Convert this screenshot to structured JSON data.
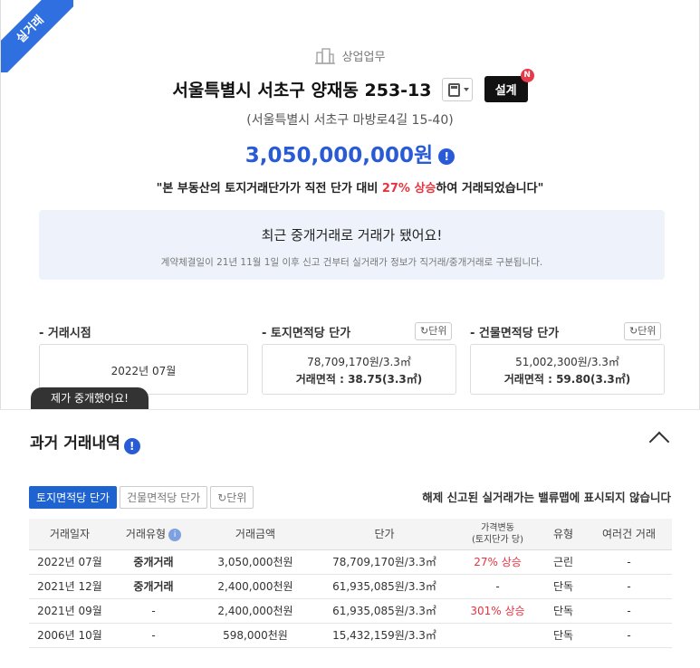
{
  "ribbon": "실거래",
  "property": {
    "category": "상업업무",
    "address": "서울특별시 서초구 양재동 253-13",
    "road_address": "(서울특별시 서초구 마방로4길 15-40)",
    "price": "3,050,000,000원",
    "design_button": "설계",
    "new_badge": "N",
    "quote_prefix": "\"본 부동산의 토지거래단가가 직전 단가 대비 ",
    "quote_highlight": "27% 상승",
    "quote_suffix": "하여 거래되었습니다\""
  },
  "notice": {
    "title": "최근 중개거래로 거래가 됐어요!",
    "subtitle": "계약체결일이 21년 11월 1일 이후 신고 건부터 실거래가 정보가 직거래/중개거래로 구분됩니다."
  },
  "summary": {
    "unit_label": "단위",
    "trade_date": {
      "label": "- 거래시점",
      "value": "2022년 07월"
    },
    "land": {
      "label": "- 토지면적당 단가",
      "unit_price": "78,709,170원/3.3㎡",
      "area": "거래면적 : 38.75(3.3㎡)"
    },
    "building": {
      "label": "- 건물면적당 단가",
      "unit_price": "51,002,300원/3.3㎡",
      "area": "거래면적 : 59.80(3.3㎡)"
    },
    "tooltip": "제가 중개했어요!"
  },
  "history": {
    "title": "과거 거래내역",
    "tabs": [
      "토지면적당 단가",
      "건물면적당 단가"
    ],
    "unit_button": "단위",
    "note": "해제 신고된 실거래가는 밸류맵에 표시되지 않습니다",
    "columns": {
      "date": "거래일자",
      "type": "거래유형",
      "amount": "거래금액",
      "unit_price": "단가",
      "change_l1": "가격변동",
      "change_l2": "(토지단가 당)",
      "kind": "유형",
      "multi": "여러건 거래"
    },
    "rows": [
      {
        "date": "2022년 07월",
        "type": "중개거래",
        "amount": "3,050,000천원",
        "unit_price": "78,709,170원/3.3㎡",
        "change": "27% 상승",
        "kind": "근린",
        "multi": "-"
      },
      {
        "date": "2021년 12월",
        "type": "중개거래",
        "amount": "2,400,000천원",
        "unit_price": "61,935,085원/3.3㎡",
        "change": "-",
        "kind": "단독",
        "multi": "-"
      },
      {
        "date": "2021년 09월",
        "type": "-",
        "amount": "2,400,000천원",
        "unit_price": "61,935,085원/3.3㎡",
        "change": "301% 상승",
        "kind": "단독",
        "multi": "-"
      },
      {
        "date": "2006년 10월",
        "type": "-",
        "amount": "598,000천원",
        "unit_price": "15,432,159원/3.3㎡",
        "change": "",
        "kind": "단독",
        "multi": "-"
      }
    ]
  },
  "icons": {
    "category": "building-icon",
    "calculator": "calculator-icon",
    "info": "info-icon",
    "refresh": "refresh-icon",
    "collapse": "chevron-up-icon"
  },
  "colors": {
    "accent": "#2a5bd7",
    "increase": "#e8333f",
    "ribbon": "#2f6fe0"
  }
}
